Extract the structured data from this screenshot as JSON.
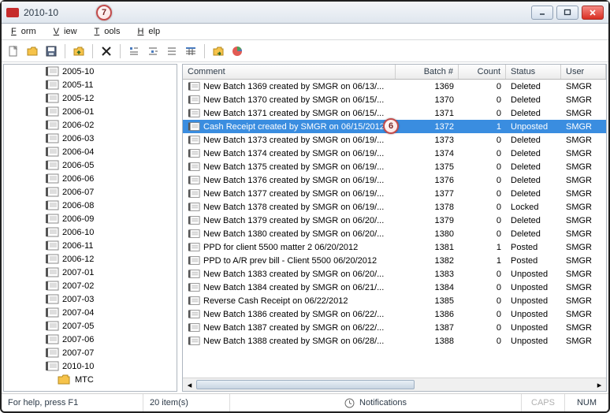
{
  "window": {
    "title": "2010-10"
  },
  "annotations": {
    "title_marker": "7",
    "row_marker": "6"
  },
  "menu": {
    "form": "Form",
    "view": "View",
    "tools": "Tools",
    "help": "Help"
  },
  "toolbar_icons": [
    "new",
    "open",
    "save",
    "folder-up",
    "delete",
    "indent-left",
    "indent-right",
    "list-small",
    "list-large",
    "grid",
    "folder-go",
    "chart-pie"
  ],
  "tree": {
    "items": [
      "2005-10",
      "2005-11",
      "2005-12",
      "2006-01",
      "2006-02",
      "2006-03",
      "2006-04",
      "2006-05",
      "2006-06",
      "2006-07",
      "2006-08",
      "2006-09",
      "2006-10",
      "2006-11",
      "2006-12",
      "2007-01",
      "2007-02",
      "2007-03",
      "2007-04",
      "2007-05",
      "2007-06",
      "2007-07",
      "2010-10"
    ],
    "child_label": "MTC"
  },
  "columns": {
    "comment": "Comment",
    "batch": "Batch #",
    "count": "Count",
    "status": "Status",
    "user": "User"
  },
  "rows": [
    {
      "comment": "New Batch 1369 created by SMGR on 06/13/...",
      "batch": 1369,
      "count": 0,
      "status": "Deleted",
      "user": "SMGR"
    },
    {
      "comment": "New Batch 1370 created by SMGR on 06/15/...",
      "batch": 1370,
      "count": 0,
      "status": "Deleted",
      "user": "SMGR"
    },
    {
      "comment": "New Batch 1371 created by SMGR on 06/15/...",
      "batch": 1371,
      "count": 0,
      "status": "Deleted",
      "user": "SMGR"
    },
    {
      "comment": "Cash Receipt created by SMGR on 06/15/2012",
      "batch": 1372,
      "count": 1,
      "status": "Unposted",
      "user": "SMGR",
      "selected": true,
      "annot": "6"
    },
    {
      "comment": "New Batch 1373 created by SMGR on 06/19/...",
      "batch": 1373,
      "count": 0,
      "status": "Deleted",
      "user": "SMGR"
    },
    {
      "comment": "New Batch 1374 created by SMGR on 06/19/...",
      "batch": 1374,
      "count": 0,
      "status": "Deleted",
      "user": "SMGR"
    },
    {
      "comment": "New Batch 1375 created by SMGR on 06/19/...",
      "batch": 1375,
      "count": 0,
      "status": "Deleted",
      "user": "SMGR"
    },
    {
      "comment": "New Batch 1376 created by SMGR on 06/19/...",
      "batch": 1376,
      "count": 0,
      "status": "Deleted",
      "user": "SMGR"
    },
    {
      "comment": "New Batch 1377 created by SMGR on 06/19/...",
      "batch": 1377,
      "count": 0,
      "status": "Deleted",
      "user": "SMGR"
    },
    {
      "comment": "New Batch 1378 created by SMGR on 06/19/...",
      "batch": 1378,
      "count": 0,
      "status": "Locked",
      "user": "SMGR"
    },
    {
      "comment": "New Batch 1379 created by SMGR on 06/20/...",
      "batch": 1379,
      "count": 0,
      "status": "Deleted",
      "user": "SMGR"
    },
    {
      "comment": "New Batch 1380 created by SMGR on 06/20/...",
      "batch": 1380,
      "count": 0,
      "status": "Deleted",
      "user": "SMGR"
    },
    {
      "comment": "PPD for client 5500 matter 2   06/20/2012",
      "batch": 1381,
      "count": 1,
      "status": "Posted",
      "user": "SMGR"
    },
    {
      "comment": "PPD to A/R prev bill - Client 5500 06/20/2012",
      "batch": 1382,
      "count": 1,
      "status": "Posted",
      "user": "SMGR"
    },
    {
      "comment": "New Batch 1383 created by SMGR on 06/20/...",
      "batch": 1383,
      "count": 0,
      "status": "Unposted",
      "user": "SMGR"
    },
    {
      "comment": "New Batch 1384 created by SMGR on 06/21/...",
      "batch": 1384,
      "count": 0,
      "status": "Unposted",
      "user": "SMGR"
    },
    {
      "comment": "Reverse Cash Receipt on 06/22/2012",
      "batch": 1385,
      "count": 0,
      "status": "Unposted",
      "user": "SMGR"
    },
    {
      "comment": "New Batch 1386 created by SMGR on 06/22/...",
      "batch": 1386,
      "count": 0,
      "status": "Unposted",
      "user": "SMGR"
    },
    {
      "comment": "New Batch 1387 created by SMGR on 06/22/...",
      "batch": 1387,
      "count": 0,
      "status": "Unposted",
      "user": "SMGR"
    },
    {
      "comment": "New Batch 1388 created by SMGR on 06/28/...",
      "batch": 1388,
      "count": 0,
      "status": "Unposted",
      "user": "SMGR"
    }
  ],
  "status": {
    "help": "For help, press F1",
    "count": "20 item(s)",
    "notifications": "Notifications",
    "caps": "CAPS",
    "num": "NUM"
  }
}
